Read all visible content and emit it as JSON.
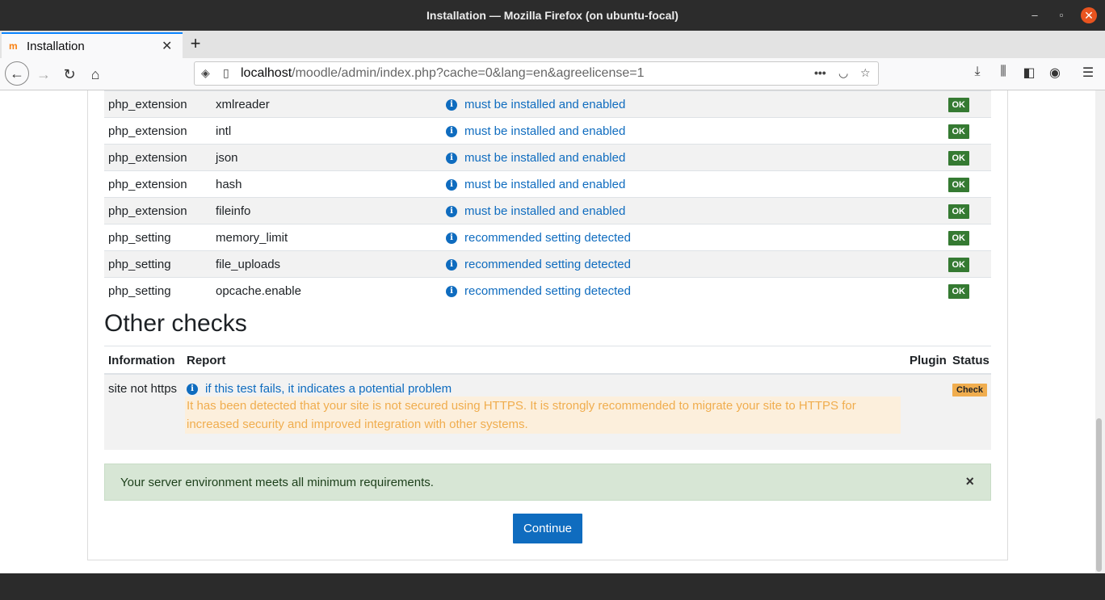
{
  "window": {
    "title": "Installation — Mozilla Firefox (on ubuntu-focal)"
  },
  "tab": {
    "label": "Installation",
    "favicon": "moodle-m-icon"
  },
  "urlbar": {
    "host": "localhost",
    "path": "/moodle/admin/index.php?cache=0&lang=en&agreelicense=1"
  },
  "env_rows": [
    {
      "type": "php_extension",
      "name": "xmlreader",
      "report": "must be installed and enabled",
      "status": "OK"
    },
    {
      "type": "php_extension",
      "name": "intl",
      "report": "must be installed and enabled",
      "status": "OK"
    },
    {
      "type": "php_extension",
      "name": "json",
      "report": "must be installed and enabled",
      "status": "OK"
    },
    {
      "type": "php_extension",
      "name": "hash",
      "report": "must be installed and enabled",
      "status": "OK"
    },
    {
      "type": "php_extension",
      "name": "fileinfo",
      "report": "must be installed and enabled",
      "status": "OK"
    },
    {
      "type": "php_setting",
      "name": "memory_limit",
      "report": "recommended setting detected",
      "status": "OK"
    },
    {
      "type": "php_setting",
      "name": "file_uploads",
      "report": "recommended setting detected",
      "status": "OK"
    },
    {
      "type": "php_setting",
      "name": "opcache.enable",
      "report": "recommended setting detected",
      "status": "OK"
    }
  ],
  "other_checks": {
    "heading": "Other checks",
    "headers": {
      "information": "Information",
      "report": "Report",
      "plugin": "Plugin",
      "status": "Status"
    },
    "row": {
      "information": "site not https",
      "report": "if this test fails, it indicates a potential problem",
      "warning": "It has been detected that your site is not secured using HTTPS. It is strongly recommended to migrate your site to HTTPS for increased security and improved integration with other systems.",
      "status": "Check"
    }
  },
  "alert": {
    "message": "Your server environment meets all minimum requirements.",
    "close": "×"
  },
  "continue_label": "Continue",
  "colors": {
    "link": "#0f6cbf",
    "ok": "#357a32",
    "warning": "#f0ad4e",
    "success_bg": "#d7e6d5"
  }
}
